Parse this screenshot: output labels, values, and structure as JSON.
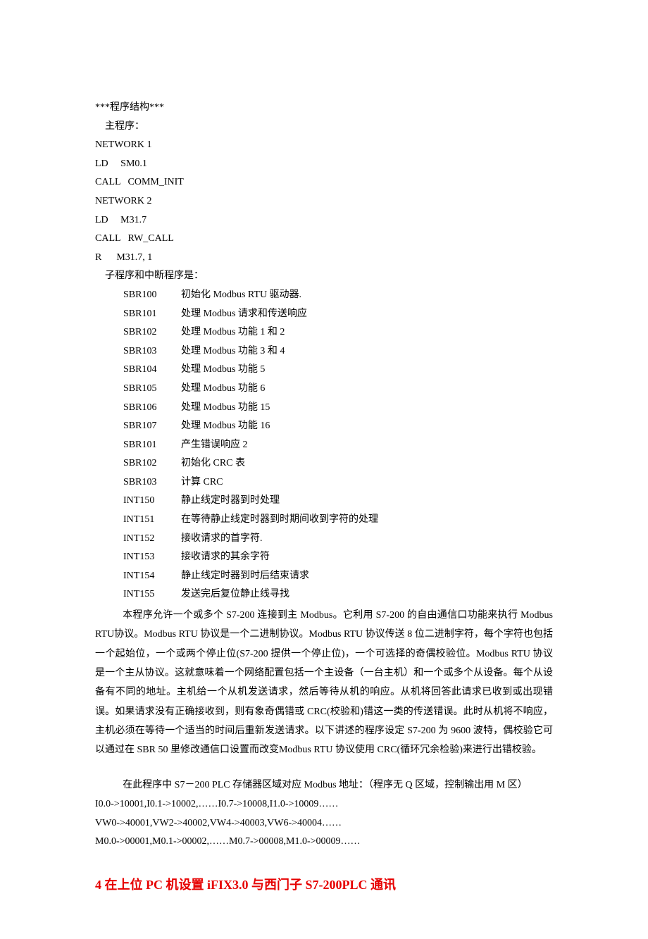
{
  "structureHeader": "***程序结构***",
  "mainProgLabel": "    主程序：",
  "mainProg": [
    "NETWORK 1",
    "LD     SM0.1",
    "CALL   COMM_INIT",
    "NETWORK 2",
    "LD     M31.7",
    "CALL   RW_CALL",
    "R      M31.7, 1"
  ],
  "subProgLabel": "    子程序和中断程序是：",
  "subs": [
    {
      "code": "SBR100",
      "desc": "初始化 Modbus RTU  驱动器."
    },
    {
      "code": "SBR101",
      "desc": "处理 Modbus  请求和传送响应"
    },
    {
      "code": "SBR102",
      "desc": "处理 Modbus  功能 1 和 2"
    },
    {
      "code": "SBR103",
      "desc": "处理 Modbus  功能 3 和 4"
    },
    {
      "code": "SBR104",
      "desc": "处理 Modbus  功能 5"
    },
    {
      "code": "SBR105",
      "desc": "处理 Modbus 功能  6"
    },
    {
      "code": "SBR106",
      "desc": "处理 Modbus  功能  15"
    },
    {
      "code": "SBR107",
      "desc": "处理 Modbus  功能  16"
    },
    {
      "code": "SBR101",
      "desc": "产生错误响应 2"
    },
    {
      "code": "SBR102",
      "desc": "初始化 CRC  表"
    },
    {
      "code": "SBR103",
      "desc": "计算 CRC"
    },
    {
      "code": "INT150",
      "desc": "静止线定时器到时处理"
    },
    {
      "code": "INT151",
      "desc": "在等待静止线定时器到时期间收到字符的处理"
    },
    {
      "code": "INT152",
      "desc": "接收请求的首字符."
    },
    {
      "code": "INT153",
      "desc": "接收请求的其余字符"
    },
    {
      "code": "INT154",
      "desc": "静止线定时器到时后结束请求"
    },
    {
      "code": "INT155",
      "desc": "发送完后复位静止线寻找"
    }
  ],
  "paragraph": "本程序允许一个或多个 S7-200 连接到主 Modbus。它利用 S7-200 的自由通信口功能来执行 Modbus RTU协议。Modbus RTU 协议是一个二进制协议。Modbus RTU 协议传送 8 位二进制字符，每个字符也包括一个起始位，一个或两个停止位(S7-200 提供一个停止位)，一个可选择的奇偶校验位。Modbus RTU 协议是一个主从协议。这就意味着一个网络配置包括一个主设备（一台主机）和一个或多个从设备。每个从设备有不同的地址。主机给一个从机发送请求，然后等待从机的响应。从机将回答此请求已收到或出现错误。如果请求没有正确接收到，则有象奇偶错或 CRC(校验和)错这一类的传送错误。此时从机将不响应，主机必须在等待一个适当的时间后重新发送请求。以下讲述的程序设定 S7-200 为 9600 波特，偶校验它可以通过在 SBR 50 里修改通信口设置而改变Modbus RTU 协议使用 CRC(循环冗余检验)来进行出错校验。",
  "addrHead": "在此程序中 S7－200 PLC 存储器区域对应 Modbus 地址：（程序无 Q 区域，控制输出用 M 区）",
  "addrLines": [
    "I0.0->10001,I0.1->10002,……I0.7->10008,I1.0->10009……",
    "VW0->40001,VW2->40002,VW4->40003,VW6->40004……",
    "M0.0->00001,M0.1->00002,……M0.7->00008,M1.0->00009……"
  ],
  "heading": {
    "num": "4",
    "pre": "在上位 PC 机设置 ",
    "ifix": "iFIX3.0",
    "post": " 与西门子 S7-200PLC 通讯"
  }
}
